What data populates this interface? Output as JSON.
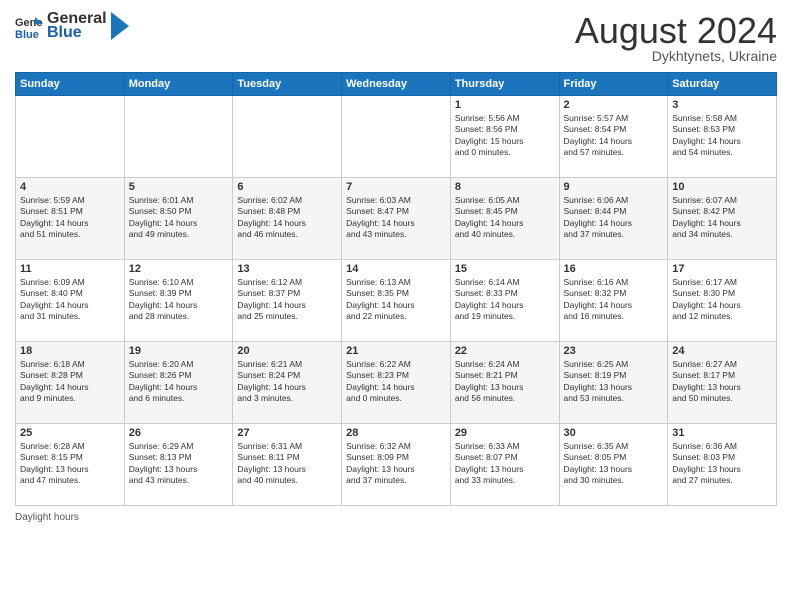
{
  "header": {
    "logo_general": "General",
    "logo_blue": "Blue",
    "month_year": "August 2024",
    "location": "Dykhtynets, Ukraine"
  },
  "days_of_week": [
    "Sunday",
    "Monday",
    "Tuesday",
    "Wednesday",
    "Thursday",
    "Friday",
    "Saturday"
  ],
  "weeks": [
    [
      {
        "num": "",
        "info": ""
      },
      {
        "num": "",
        "info": ""
      },
      {
        "num": "",
        "info": ""
      },
      {
        "num": "",
        "info": ""
      },
      {
        "num": "1",
        "info": "Sunrise: 5:56 AM\nSunset: 8:56 PM\nDaylight: 15 hours\nand 0 minutes."
      },
      {
        "num": "2",
        "info": "Sunrise: 5:57 AM\nSunset: 8:54 PM\nDaylight: 14 hours\nand 57 minutes."
      },
      {
        "num": "3",
        "info": "Sunrise: 5:58 AM\nSunset: 8:53 PM\nDaylight: 14 hours\nand 54 minutes."
      }
    ],
    [
      {
        "num": "4",
        "info": "Sunrise: 5:59 AM\nSunset: 8:51 PM\nDaylight: 14 hours\nand 51 minutes."
      },
      {
        "num": "5",
        "info": "Sunrise: 6:01 AM\nSunset: 8:50 PM\nDaylight: 14 hours\nand 49 minutes."
      },
      {
        "num": "6",
        "info": "Sunrise: 6:02 AM\nSunset: 8:48 PM\nDaylight: 14 hours\nand 46 minutes."
      },
      {
        "num": "7",
        "info": "Sunrise: 6:03 AM\nSunset: 8:47 PM\nDaylight: 14 hours\nand 43 minutes."
      },
      {
        "num": "8",
        "info": "Sunrise: 6:05 AM\nSunset: 8:45 PM\nDaylight: 14 hours\nand 40 minutes."
      },
      {
        "num": "9",
        "info": "Sunrise: 6:06 AM\nSunset: 8:44 PM\nDaylight: 14 hours\nand 37 minutes."
      },
      {
        "num": "10",
        "info": "Sunrise: 6:07 AM\nSunset: 8:42 PM\nDaylight: 14 hours\nand 34 minutes."
      }
    ],
    [
      {
        "num": "11",
        "info": "Sunrise: 6:09 AM\nSunset: 8:40 PM\nDaylight: 14 hours\nand 31 minutes."
      },
      {
        "num": "12",
        "info": "Sunrise: 6:10 AM\nSunset: 8:39 PM\nDaylight: 14 hours\nand 28 minutes."
      },
      {
        "num": "13",
        "info": "Sunrise: 6:12 AM\nSunset: 8:37 PM\nDaylight: 14 hours\nand 25 minutes."
      },
      {
        "num": "14",
        "info": "Sunrise: 6:13 AM\nSunset: 8:35 PM\nDaylight: 14 hours\nand 22 minutes."
      },
      {
        "num": "15",
        "info": "Sunrise: 6:14 AM\nSunset: 8:33 PM\nDaylight: 14 hours\nand 19 minutes."
      },
      {
        "num": "16",
        "info": "Sunrise: 6:16 AM\nSunset: 8:32 PM\nDaylight: 14 hours\nand 16 minutes."
      },
      {
        "num": "17",
        "info": "Sunrise: 6:17 AM\nSunset: 8:30 PM\nDaylight: 14 hours\nand 12 minutes."
      }
    ],
    [
      {
        "num": "18",
        "info": "Sunrise: 6:18 AM\nSunset: 8:28 PM\nDaylight: 14 hours\nand 9 minutes."
      },
      {
        "num": "19",
        "info": "Sunrise: 6:20 AM\nSunset: 8:26 PM\nDaylight: 14 hours\nand 6 minutes."
      },
      {
        "num": "20",
        "info": "Sunrise: 6:21 AM\nSunset: 8:24 PM\nDaylight: 14 hours\nand 3 minutes."
      },
      {
        "num": "21",
        "info": "Sunrise: 6:22 AM\nSunset: 8:23 PM\nDaylight: 14 hours\nand 0 minutes."
      },
      {
        "num": "22",
        "info": "Sunrise: 6:24 AM\nSunset: 8:21 PM\nDaylight: 13 hours\nand 56 minutes."
      },
      {
        "num": "23",
        "info": "Sunrise: 6:25 AM\nSunset: 8:19 PM\nDaylight: 13 hours\nand 53 minutes."
      },
      {
        "num": "24",
        "info": "Sunrise: 6:27 AM\nSunset: 8:17 PM\nDaylight: 13 hours\nand 50 minutes."
      }
    ],
    [
      {
        "num": "25",
        "info": "Sunrise: 6:28 AM\nSunset: 8:15 PM\nDaylight: 13 hours\nand 47 minutes."
      },
      {
        "num": "26",
        "info": "Sunrise: 6:29 AM\nSunset: 8:13 PM\nDaylight: 13 hours\nand 43 minutes."
      },
      {
        "num": "27",
        "info": "Sunrise: 6:31 AM\nSunset: 8:11 PM\nDaylight: 13 hours\nand 40 minutes."
      },
      {
        "num": "28",
        "info": "Sunrise: 6:32 AM\nSunset: 8:09 PM\nDaylight: 13 hours\nand 37 minutes."
      },
      {
        "num": "29",
        "info": "Sunrise: 6:33 AM\nSunset: 8:07 PM\nDaylight: 13 hours\nand 33 minutes."
      },
      {
        "num": "30",
        "info": "Sunrise: 6:35 AM\nSunset: 8:05 PM\nDaylight: 13 hours\nand 30 minutes."
      },
      {
        "num": "31",
        "info": "Sunrise: 6:36 AM\nSunset: 8:03 PM\nDaylight: 13 hours\nand 27 minutes."
      }
    ]
  ],
  "footer": {
    "daylight_hours": "Daylight hours"
  }
}
